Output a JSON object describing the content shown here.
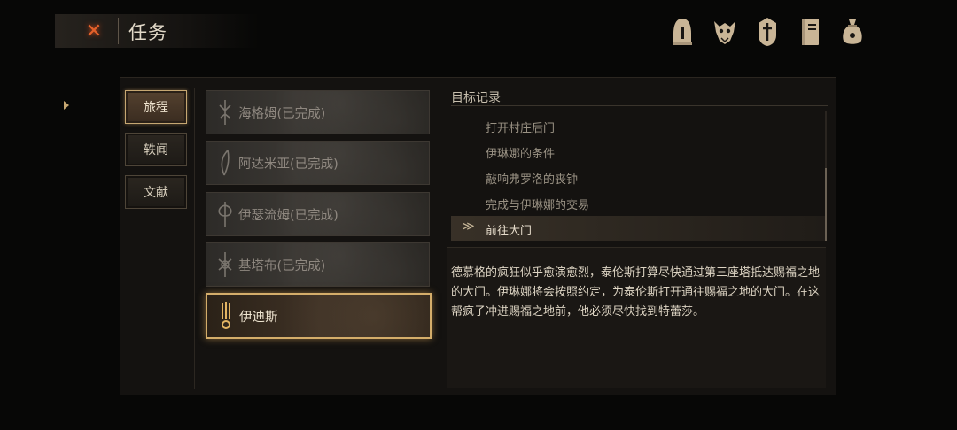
{
  "header": {
    "title": "任务",
    "close_icon": "close-x-icon"
  },
  "top_icons": [
    "helmet-icon",
    "beast-skull-icon",
    "knight-helm-icon",
    "journal-book-icon",
    "coin-pouch-icon"
  ],
  "categories": [
    {
      "label": "旅程",
      "active": true
    },
    {
      "label": "轶闻",
      "active": false
    },
    {
      "label": "文献",
      "active": false
    }
  ],
  "quests": [
    {
      "label": "海格姆(已完成)",
      "icon": "sigil-icon",
      "active": false
    },
    {
      "label": "阿达米亚(已完成)",
      "icon": "feather-sigil-icon",
      "active": false
    },
    {
      "label": "伊瑟流姆(已完成)",
      "icon": "axe-sigil-icon",
      "active": false
    },
    {
      "label": "基塔布(已完成)",
      "icon": "ornate-sigil-icon",
      "active": false
    },
    {
      "label": "伊迪斯",
      "icon": "flame-sigil-icon",
      "active": true
    }
  ],
  "objectives": {
    "header": "目标记录",
    "items": [
      {
        "label": "打开村庄后门",
        "current": false
      },
      {
        "label": "伊琳娜的条件",
        "current": false
      },
      {
        "label": "敲响弗罗洛的丧钟",
        "current": false
      },
      {
        "label": "完成与伊琳娜的交易",
        "current": false
      },
      {
        "label": "前往大门",
        "current": true
      }
    ],
    "current_marker": "≫"
  },
  "description": "德慕格的疯狂似乎愈演愈烈，泰伦斯打算尽快通过第三座塔抵达赐福之地的大门。伊琳娜将会按照约定，为泰伦斯打开通往赐福之地的大门。在这帮疯子冲进赐福之地前，他必须尽快找到特蕾莎。",
  "colors": {
    "accent_gold": "#d4ad6a",
    "close_orange": "#e4612a",
    "background": "#070706"
  }
}
